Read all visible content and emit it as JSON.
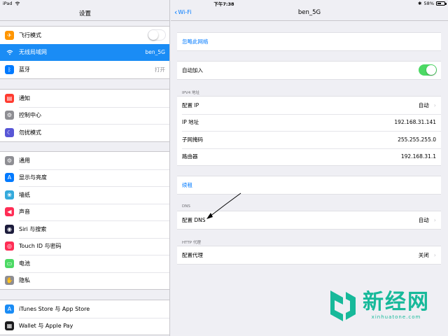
{
  "status": {
    "device": "iPad",
    "time": "下午7:38",
    "bluetooth": "✱",
    "battery": "58%",
    "battery_fraction": 0.58
  },
  "left": {
    "title": "设置",
    "group1": [
      {
        "label": "飞行模式",
        "icon": "airplane-icon",
        "color": "#ff9500",
        "toggle": "off"
      },
      {
        "label": "无线局域网",
        "value": "ben_5G",
        "icon": "wifi-icon",
        "color": "#007aff",
        "selected": true
      },
      {
        "label": "蓝牙",
        "value": "打开",
        "icon": "bluetooth-icon",
        "color": "#007aff"
      }
    ],
    "group2": [
      {
        "label": "通知",
        "icon": "notifications-icon",
        "color": "#ff3b30"
      },
      {
        "label": "控制中心",
        "icon": "control-center-icon",
        "color": "#8e8e93"
      },
      {
        "label": "勿扰模式",
        "icon": "moon-icon",
        "color": "#5856d6"
      }
    ],
    "group3": [
      {
        "label": "通用",
        "icon": "gear-icon",
        "color": "#8e8e93"
      },
      {
        "label": "显示与亮度",
        "icon": "display-icon",
        "color": "#007aff"
      },
      {
        "label": "墙纸",
        "icon": "wallpaper-icon",
        "color": "#34aadc"
      },
      {
        "label": "声音",
        "icon": "sound-icon",
        "color": "#ff2d55"
      },
      {
        "label": "Siri 与搜索",
        "icon": "siri-icon",
        "color": "#1c1c3c"
      },
      {
        "label": "Touch ID 与密码",
        "icon": "fingerprint-icon",
        "color": "#ff2d55"
      },
      {
        "label": "电池",
        "icon": "battery-icon",
        "color": "#4cd964"
      },
      {
        "label": "隐私",
        "icon": "privacy-hand-icon",
        "color": "#8e8e93"
      }
    ],
    "group4": [
      {
        "label": "iTunes Store 与 App Store",
        "icon": "app-store-icon",
        "color": "#1a8cf5"
      },
      {
        "label": "Wallet 与 Apple Pay",
        "icon": "wallet-icon",
        "color": "#1c1c1e"
      }
    ]
  },
  "right": {
    "back_label": "Wi-Fi",
    "title": "ben_5G",
    "forget": "忽略此网络",
    "auto_join": {
      "label": "自动加入",
      "toggle": "on"
    },
    "ipv4_header": "IPV4 地址",
    "ipv4": [
      {
        "label": "配置 IP",
        "value": "自动",
        "chevron": true
      },
      {
        "label": "IP 地址",
        "value": "192.168.31.141"
      },
      {
        "label": "子网掩码",
        "value": "255.255.255.0"
      },
      {
        "label": "路由器",
        "value": "192.168.31.1"
      }
    ],
    "renew": "续租",
    "dns_header": "DNS",
    "dns": {
      "label": "配置 DNS",
      "value": "自动"
    },
    "proxy_header": "HTTP 代理",
    "proxy": {
      "label": "配置代理",
      "value": "关闭"
    }
  },
  "watermark": {
    "cn": "新经网",
    "en": "xinhuatone.com"
  },
  "colors": {
    "accent": "#007aff",
    "selected": "#1a8cf5",
    "toggle_on": "#4cd964",
    "watermark": "#17b99a"
  }
}
